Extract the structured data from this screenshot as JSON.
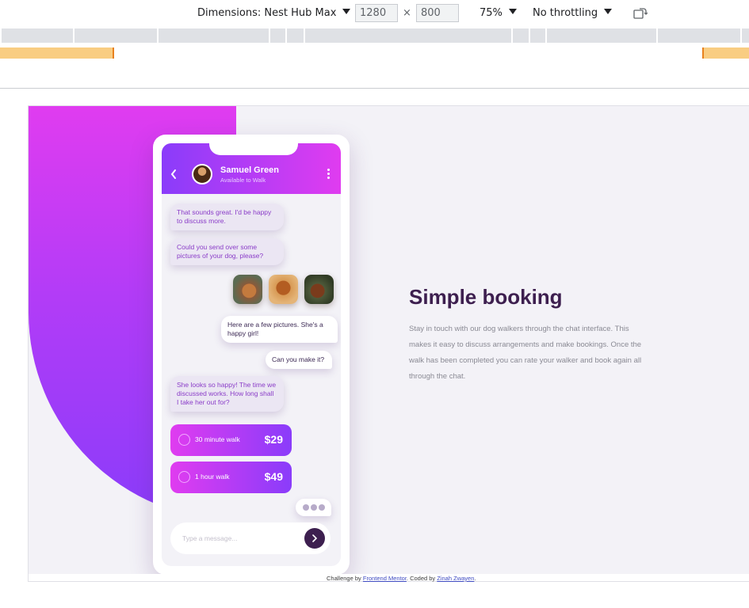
{
  "devtools": {
    "dimensions_label": "Dimensions: Nest Hub Max",
    "width_value": "1280",
    "times_glyph": "×",
    "height_value": "800",
    "zoom_label": "75%",
    "throttling_label": "No throttling"
  },
  "chat": {
    "contact_name": "Samuel Green",
    "contact_status": "Available to Walk",
    "messages": [
      {
        "direction": "in",
        "text": "That sounds great. I'd be happy to discuss more."
      },
      {
        "direction": "in",
        "text": "Could you send over some pictures of your dog, please?"
      },
      {
        "direction": "out",
        "text": "Here are a few pictures. She's a happy girl!"
      },
      {
        "direction": "out",
        "text": "Can you make it?"
      },
      {
        "direction": "in",
        "text": "She looks so happy! The time we discussed works. How long shall I take her out for?"
      }
    ],
    "plans": [
      {
        "label": "30 minute walk",
        "price": "$29"
      },
      {
        "label": "1 hour walk",
        "price": "$49"
      }
    ],
    "composer_placeholder": "Type a message..."
  },
  "feature": {
    "title": "Simple booking",
    "body": "Stay in touch with our dog walkers through the chat interface. This makes it easy to discuss arrangements and make bookings. Once the walk has been completed you can rate your walker and book again all through the chat."
  },
  "attribution": {
    "prefix": "Challenge by ",
    "link1": "Frontend Mentor",
    "middle": ". Coded by ",
    "link2": "Zinah Zwayen",
    "suffix": "."
  },
  "colors": {
    "accent_magenta": "#e03cf0",
    "accent_violet": "#8a3cfa",
    "dark_purple": "#3d1f4f",
    "page_bg": "#f3f2f7"
  }
}
